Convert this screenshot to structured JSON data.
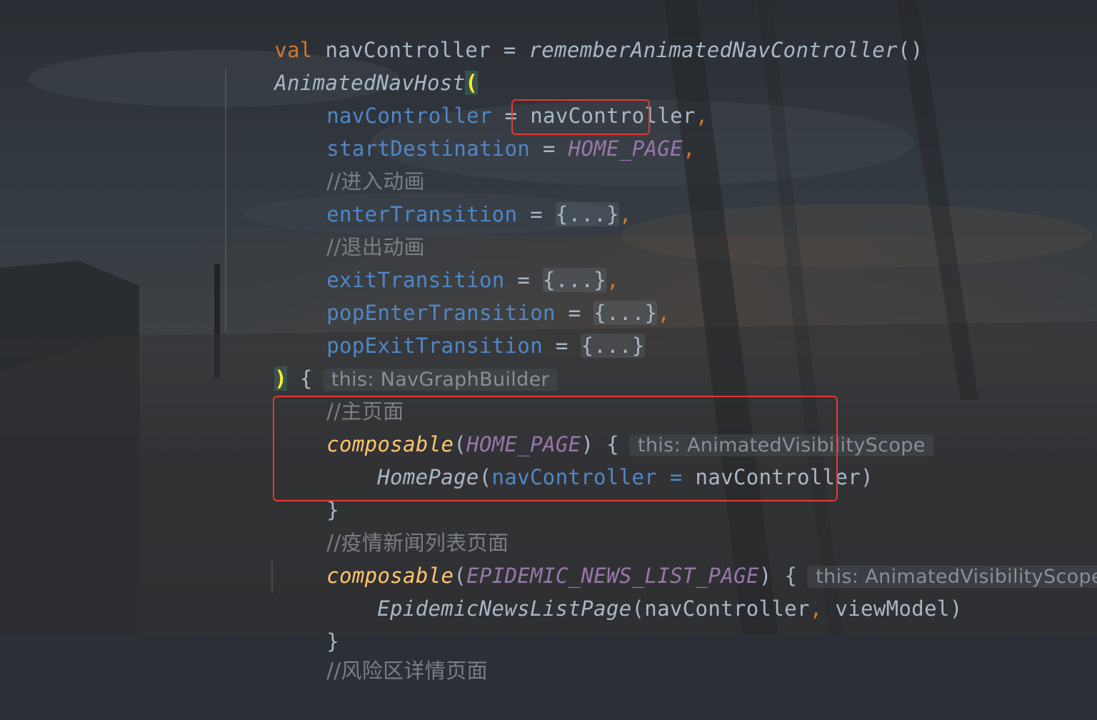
{
  "lines": {
    "l1": {
      "a": "val",
      "b": " navController = ",
      "c": "rememberAnimatedNavController",
      "d": "()"
    },
    "l2": {
      "a": "AnimatedNavHost",
      "b": "("
    },
    "l3": {
      "a": "navController",
      "b": " = ",
      "c": "navController",
      "d": ","
    },
    "l4": {
      "a": "startDestination",
      "b": " = ",
      "c": "HOME_PAGE",
      "d": ","
    },
    "l5": {
      "a": "//进入动画"
    },
    "l6": {
      "a": "enterTransition",
      "b": " = ",
      "c": "{...}",
      "d": ","
    },
    "l7": {
      "a": "//退出动画"
    },
    "l8": {
      "a": "exitTransition",
      "b": " = ",
      "c": "{...}",
      "d": ","
    },
    "l9": {
      "a": "popEnterTransition",
      "b": " = ",
      "c": "{...}",
      "d": ","
    },
    "l10": {
      "a": "popExitTransition",
      "b": " = ",
      "c": "{...}"
    },
    "l11": {
      "a": ")",
      "b": " {",
      "hint": "this: NavGraphBuilder"
    },
    "l12": {
      "a": "//主页面"
    },
    "l13": {
      "a": "composable",
      "b": "(",
      "c": "HOME_PAGE",
      "d": ") {",
      "hint": "this: AnimatedVisibilityScope"
    },
    "l14": {
      "a": "HomePage",
      "b": "(",
      "c": "navController",
      "d": " = ",
      "e": "navController",
      "f": ")"
    },
    "l15": {
      "a": "}"
    },
    "l16": {
      "a": "//疫情新闻列表页面"
    },
    "l17": {
      "a": "composable",
      "b": "(",
      "c": "EPIDEMIC_NEWS_LIST_PAGE",
      "d": ") {",
      "hint": "this: AnimatedVisibilityScope"
    },
    "l18": {
      "a": "EpidemicNewsListPage",
      "b": "(",
      "c": "navController",
      "d": ",",
      "e": " viewModel",
      "f": ")"
    },
    "l19": {
      "a": "}"
    },
    "l20": {
      "a": "//风险区详情页面"
    }
  },
  "colors": {
    "keyword": "#cc7832",
    "parameter": "#4f87c8",
    "constant": "#9876aa",
    "function_call": "#ffc66d",
    "comment": "#7a7e85",
    "highlight_box": "#e53935"
  }
}
